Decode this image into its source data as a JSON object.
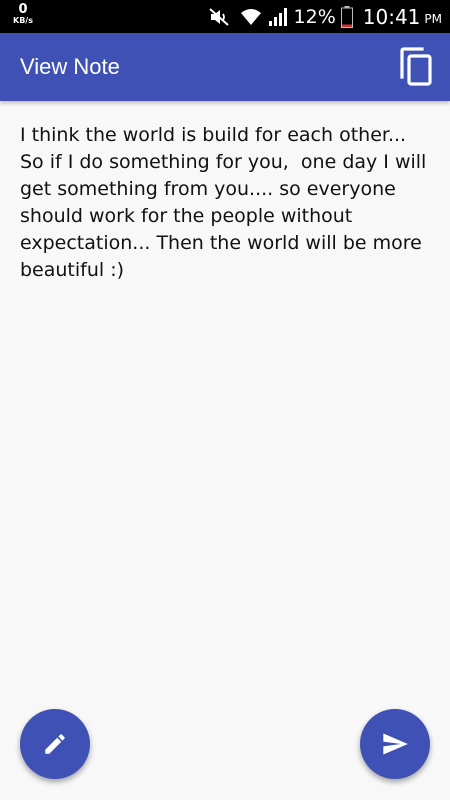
{
  "status_bar": {
    "net_speed_value": "0",
    "net_speed_unit": "KB/s",
    "battery_percent": "12%",
    "time": "10:41",
    "ampm": "PM"
  },
  "app_bar": {
    "title": "View Note",
    "copy_icon": "copy-icon"
  },
  "note": {
    "text": "I think the world is build for each other... So if I do something for you,  one day I will get something from you.... so everyone should work for the people without expectation... Then the world will be more beautiful :)"
  },
  "fabs": {
    "edit_icon": "pencil-icon",
    "send_icon": "send-icon"
  },
  "colors": {
    "primary": "#3f51b5",
    "status_bar": "#000000",
    "background": "#f8f8f8",
    "battery_low": "#d32f2f"
  }
}
